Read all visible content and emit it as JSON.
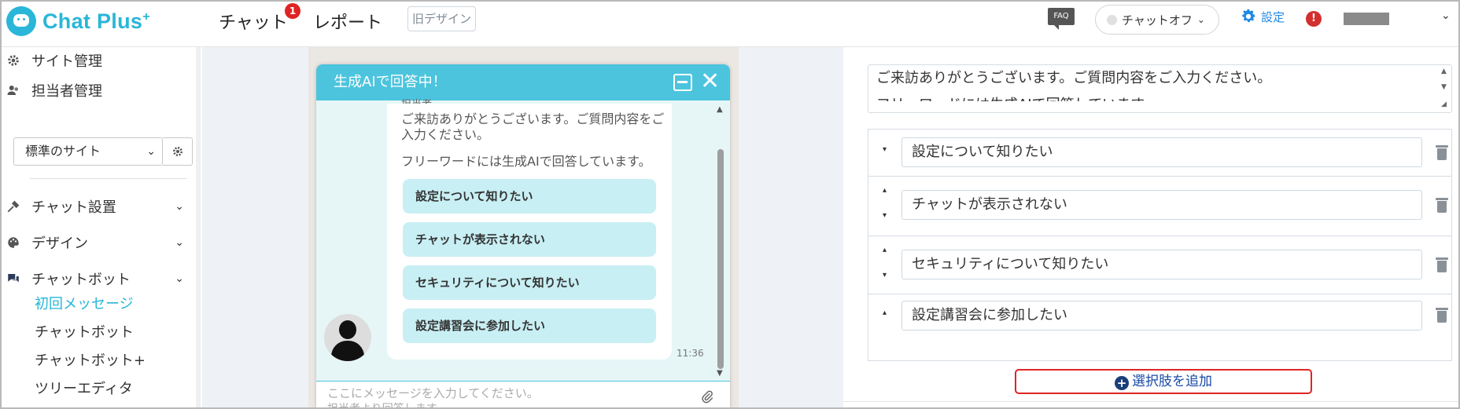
{
  "header": {
    "logo_text": "Chat Plus",
    "logo_sup": "+",
    "nav": [
      {
        "label": "チャット",
        "badge": "1"
      },
      {
        "label": "レポート"
      }
    ],
    "old_design": "旧デザイン",
    "faq": "FAQ",
    "chat_status": "チャットオフ",
    "settings": "設定",
    "alert": "!"
  },
  "sidebar": {
    "top_items": [
      {
        "label": "サイト管理",
        "icon": "gear-icon"
      },
      {
        "label": "担当者管理",
        "icon": "users-icon"
      }
    ],
    "site_select": "標準のサイト",
    "sections": [
      {
        "label": "チャット設置",
        "icon": "tools-icon"
      },
      {
        "label": "デザイン",
        "icon": "palette-icon"
      },
      {
        "label": "チャットボット",
        "icon": "chat-icon"
      }
    ],
    "sub_items": [
      {
        "label": "初回メッセージ",
        "active": true
      },
      {
        "label": "チャットボット"
      },
      {
        "label": "チャットボット+"
      },
      {
        "label": "ツリーエディタ"
      }
    ]
  },
  "widget": {
    "title": "生成AIで回答中！",
    "agent_label": "担当者",
    "message_line1": "ご来訪ありがとうございます。ご質問内容をご",
    "message_line2": "入力ください。",
    "message_line3": "フリーワードには生成AIで回答しています。",
    "options": [
      "設定について知りたい",
      "チャットが表示されない",
      "セキュリティについて知りたい",
      "設定講習会に参加したい"
    ],
    "time": "11:36",
    "input_placeholder": "ここにメッセージを入力してください。",
    "input_sub": "担当者より回答します"
  },
  "editor": {
    "message_line1": "ご来訪ありがとうございます。ご質問内容をご入力ください。",
    "message_line2": "フリーワードには生成AIで回答しています。",
    "choices": [
      "設定について知りたい",
      "チャットが表示されない",
      "セキュリティについて知りたい",
      "設定講習会に参加したい"
    ],
    "add_label": "選択肢を追加"
  }
}
